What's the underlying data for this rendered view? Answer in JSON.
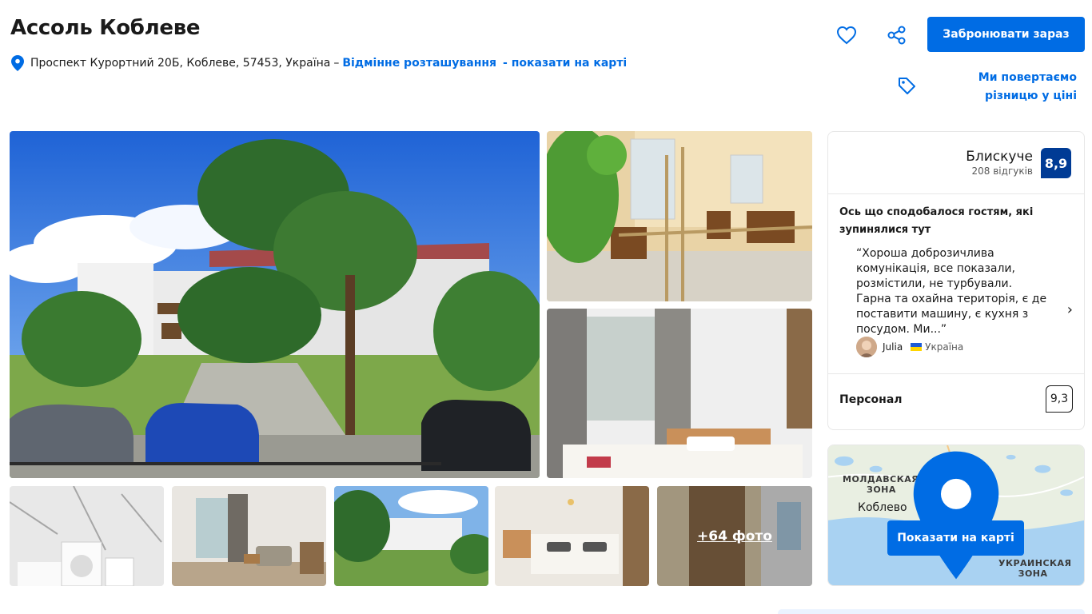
{
  "header": {
    "title": "Ассоль Коблеве",
    "address": "Проспект Курортний 20Б, Коблеве, 57453, Україна",
    "address_dash": "–",
    "location_link": "Відмінне розташування",
    "map_link": "- показати на карті"
  },
  "actions": {
    "favorite_icon": "heart-icon",
    "share_icon": "share-icon",
    "book_button": "Забронювати зараз",
    "price_match_line1": "Ми повертаємо",
    "price_match_line2": "різницю у ціні",
    "price_tag_icon": "tag-icon"
  },
  "gallery": {
    "more_photos": "+64 фото"
  },
  "reviews": {
    "score_label": "Блискуче",
    "review_count": "208 відгуків",
    "score": "8,9",
    "liked_title": "Ось що сподобалося гостям, які зупинялися тут",
    "quote": "“Хороша доброзичлива комунікація, все показали, розмістили, не турбували. Гарна та охайна територія, є де поставити машину, є кухня з посудом. Ми...”",
    "reviewer_name": "Julia",
    "reviewer_country": "Україна",
    "staff_label": "Персонал",
    "staff_score": "9,3"
  },
  "map": {
    "label_moldova_1": "МОЛДАВСКАЯ",
    "label_moldova_2": "ЗОНА",
    "city": "Коблево",
    "label_ukr_1": "УКРАИНСКАЯ",
    "label_ukr_2": "ЗОНА",
    "button": "Показати на карті"
  },
  "colors": {
    "brand_blue": "#006ce4",
    "score_blue": "#003b95"
  }
}
